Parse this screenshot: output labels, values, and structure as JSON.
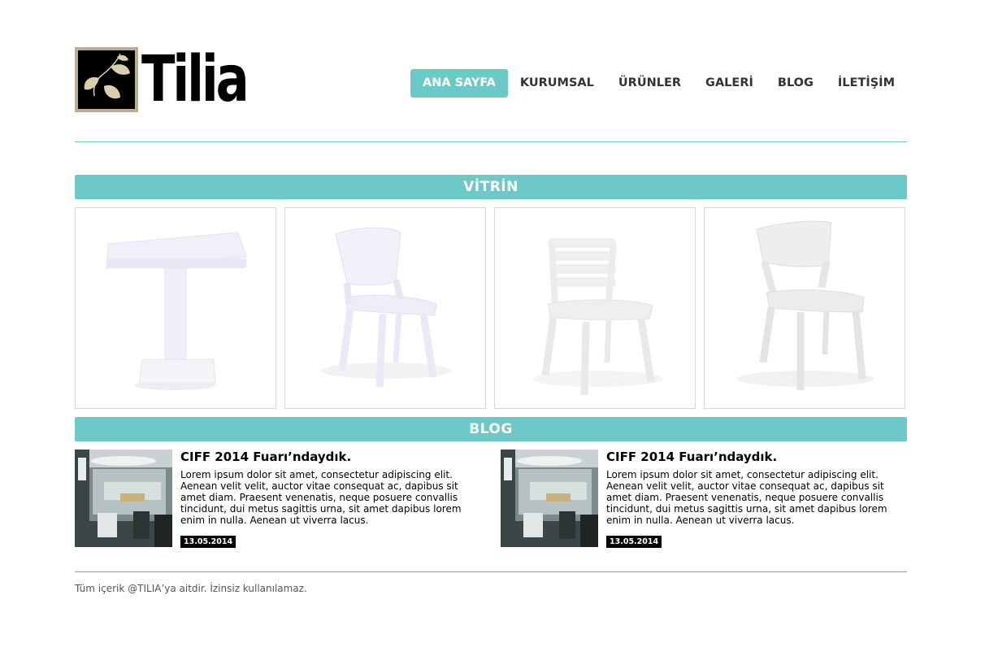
{
  "brand": {
    "logo_text": "Tilia"
  },
  "nav": {
    "items": [
      {
        "label": "ANA SAYFA",
        "active": true
      },
      {
        "label": "KURUMSAL",
        "active": false
      },
      {
        "label": "ÜRÜNLER",
        "active": false
      },
      {
        "label": "GALERİ",
        "active": false
      },
      {
        "label": "BLOG",
        "active": false
      },
      {
        "label": "İLETİŞİM",
        "active": false
      }
    ]
  },
  "sections": {
    "vitrin_title": "VİTRİN",
    "blog_title": "BLOG"
  },
  "vitrin": {
    "products": [
      {
        "kind": "table"
      },
      {
        "kind": "chair-rattan"
      },
      {
        "kind": "chair-slatted"
      },
      {
        "kind": "chair-curved"
      }
    ]
  },
  "blog": {
    "posts": [
      {
        "title": "CIFF 2014 Fuarı’ndaydık.",
        "body": "Lorem ipsum dolor sit amet, consectetur adipiscing elit. Aenean velit velit, auctor vitae consequat ac, dapibus sit amet diam. Praesent venenatis, neque posuere convallis tincidunt, dui metus sagittis urna, sit amet dapibus lorem enim in nulla. Aenean ut viverra lacus.",
        "date": "13.05.2014"
      },
      {
        "title": "CIFF 2014 Fuarı’ndaydık.",
        "body": "Lorem ipsum dolor sit amet, consectetur adipiscing elit. Aenean velit velit, auctor vitae consequat ac, dapibus sit amet diam. Praesent venenatis, neque posuere convallis tincidunt, dui metus sagittis urna, sit amet dapibus lorem enim in nulla. Aenean ut viverra lacus.",
        "date": "13.05.2014"
      }
    ]
  },
  "footer": {
    "text": "Tüm içerik @TILIA’ya aitdir. İzinsiz kullanılamaz."
  },
  "colors": {
    "accent": "#6cc9c7",
    "logo_frame": "#b9ad92"
  }
}
